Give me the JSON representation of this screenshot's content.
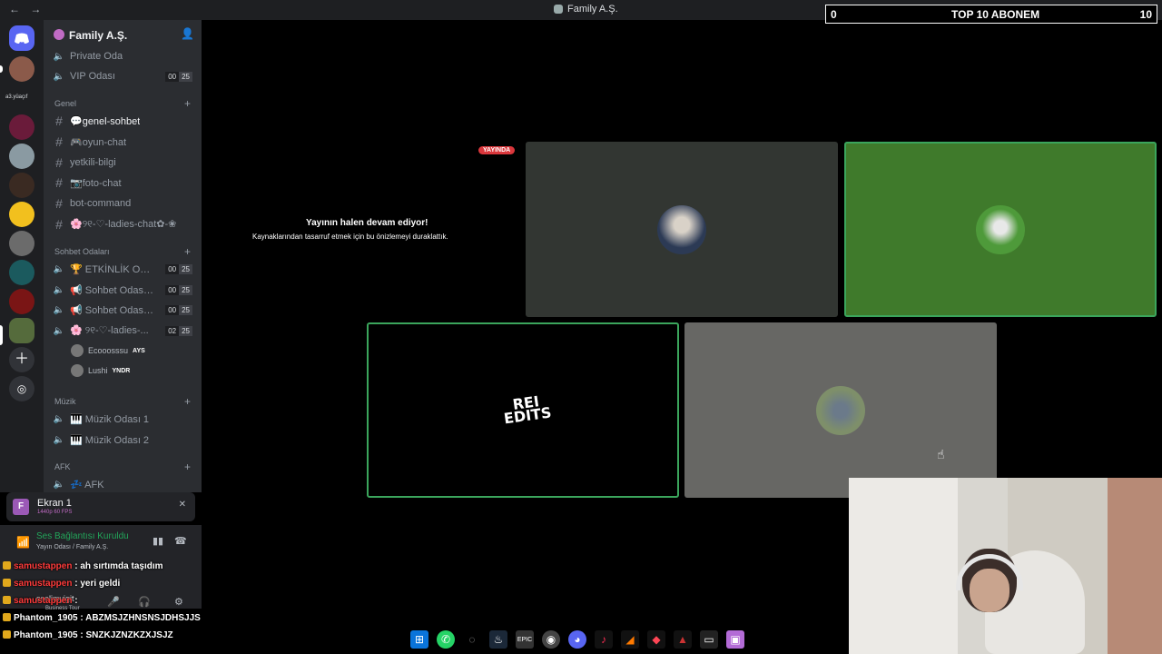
{
  "titlebar": {
    "back": "←",
    "forward": "→",
    "title": "Family A.Ş."
  },
  "stream_overlay": {
    "left_count": "0",
    "label": "TOP 10 ABONEM",
    "right_count": "10"
  },
  "server_rail": {
    "folder_label": "a3.yüaçıf"
  },
  "server": {
    "name": "Family A.Ş."
  },
  "channels": {
    "private_oda": "Private Oda",
    "vip_odasi": {
      "label": "VIP Odası",
      "users": "00",
      "limit": "25"
    },
    "category_genel": "Genel",
    "genel_sohbet": "💬genel-sohbet",
    "oyun_chat": "🎮oyun-chat",
    "yetkili_bilgi": "yetkili-bilgi",
    "foto_chat": "📷foto-chat",
    "bot_command": "bot-command",
    "ladies_chat": "🌸୨୧-♡-ladies-chat✿-❀",
    "category_sohbet": "Sohbet Odaları",
    "etkinlik": {
      "label": "🏆 ETKİNLİK Od...",
      "users": "00",
      "limit": "25"
    },
    "sohbet1": {
      "label": "📢 Sohbet Odası 1",
      "users": "00",
      "limit": "25"
    },
    "sohbet2": {
      "label": "📢 Sohbet Odası 2",
      "users": "00",
      "limit": "25"
    },
    "ladies_voice": {
      "label": "🌸 ୨୧-♡-ladies-...",
      "users": "02",
      "limit": "25"
    },
    "voice_users": [
      {
        "name": "Ecooosssu",
        "tag": "AYS"
      },
      {
        "name": "Lushi",
        "tag": "YNDR"
      }
    ],
    "category_muzik": "Müzik",
    "muzik1": "🎹 Müzik Odası 1",
    "muzik2": "🎹 Müzik Odası 2",
    "category_afk": "AFK",
    "afk": "💤 AFK"
  },
  "screen_panel": {
    "avatar_letter": "F",
    "name": "Ekran 1",
    "quality": "1440p 60 FPS"
  },
  "voice_status": {
    "title": "Ses Bağlantısı Kuruldu",
    "subtitle": "Yayın Odası / Family A.Ş."
  },
  "user_panel": {
    "name": "sselimyigit",
    "status": "Business Tour"
  },
  "chat_messages": [
    {
      "nick": "samustappen",
      "sep": " : ",
      "text": "ah sırtımda taşıdım"
    },
    {
      "nick": "samustappen",
      "sep": " : ",
      "text": "yeri geldi"
    },
    {
      "nick": "samustappen",
      "sep": " : ",
      "text": ""
    },
    {
      "nick": "Phantom_1905",
      "sep": " : ",
      "text": "ABZMSJZHNSNSJDHSJJS"
    },
    {
      "nick": "Phantom_1905",
      "sep": " : ",
      "text": "SNZKJZNZKZXJSJZ"
    }
  ],
  "stage": {
    "live_badge": "YAYINDA",
    "paused_title": "Yayının halen devam ediyor!",
    "paused_subtitle": "Kaynaklarından tasarruf etmek için bu önizlemeyi duraklattık.",
    "tile3_logo_line1": "REI",
    "tile3_logo_line2": "EDITS"
  },
  "colors": {
    "discord_bg": "#2b2d31",
    "rail_bg": "#1e1f22",
    "speaking_green": "#3ba55c",
    "live_red": "#da373c",
    "chat_nick_red": "#ff3b3b"
  },
  "taskbar_icons": [
    "windows-icon",
    "whatsapp-icon",
    "browser-icon",
    "steam-icon",
    "epic-icon",
    "chrome-icon",
    "discord-icon",
    "tiktok-icon",
    "app-icon",
    "valorant-icon",
    "game-icon",
    "terminal-icon",
    "photos-icon"
  ]
}
